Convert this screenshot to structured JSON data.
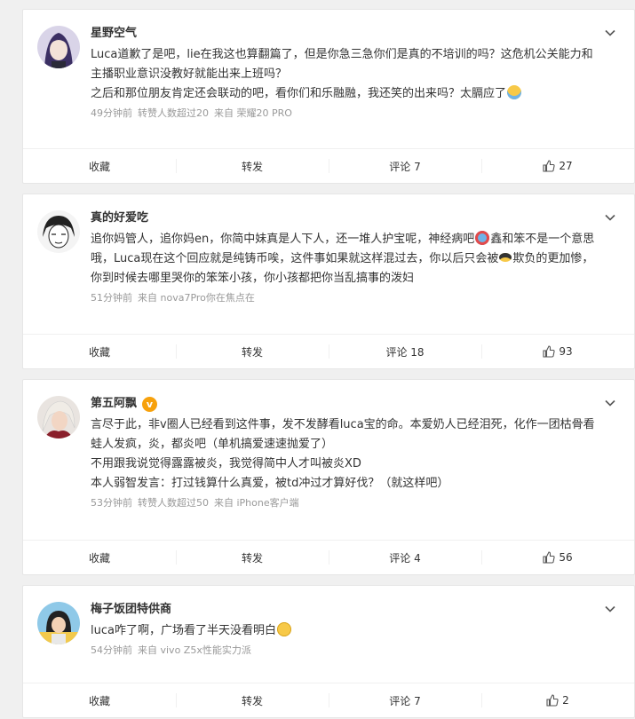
{
  "posts": [
    {
      "username": "星野空气",
      "verified": false,
      "text_1": "Luca道歉了是吧，lie在我这也算翻篇了，但是你急三急你们是真的不培训的吗？这危机公关能力和主播职业意识没教好就能出来上班吗？",
      "text_2": "之后和那位朋友肯定还会联动的吧，看你们和乐融融，我还笑的出来吗？太膈应了",
      "time": "49分钟前",
      "forward_note": "转赞人数超过20",
      "source": "来自 荣耀20 PRO",
      "actions": {
        "collect": "收藏",
        "forward": "转发",
        "comment": "评论 7",
        "like": "27"
      }
    },
    {
      "username": "真的好爱吃",
      "verified": false,
      "text_1": "追你妈管人，追你妈en，你简中妹真是人下人，还一堆人护宝呢，神经病吧",
      "text_2": "鑫和笨不是一个意思哦，Luca现在这个回应就是纯铸币唉，这件事如果就这样混过去，你以后只会被",
      "text_3": "欺负的更加惨，你到时候去哪里哭你的笨笨小孩，你小孩都把你当乱搞事的泼妇",
      "time": "51分钟前",
      "source": "来自 nova7Pro你在焦点在",
      "actions": {
        "collect": "收藏",
        "forward": "转发",
        "comment": "评论 18",
        "like": "93"
      }
    },
    {
      "username": "第五阿飘",
      "verified": true,
      "verified_mark": "v",
      "text_1": "言尽于此，非v圈人已经看到这件事，发不发酵看luca宝的命。本爱奶人已经泪死，化作一团枯骨看蛙人发疯，炎，都炎吧（单机搞爱速速抛爱了）",
      "text_2": "不用跟我说觉得露露被炎，我觉得简中人才叫被炎XD",
      "text_3": "本人弱智发言：打过钱算什么真爱，被td冲过才算好伐？（就这样吧）",
      "time": "53分钟前",
      "forward_note": "转赞人数超过50",
      "source": "来自 iPhone客户端",
      "actions": {
        "collect": "收藏",
        "forward": "转发",
        "comment": "评论 4",
        "like": "56"
      }
    },
    {
      "username": "梅子饭团特供商",
      "verified": false,
      "text_1": "luca咋了啊，广场看了半天没看明白",
      "time": "54分钟前",
      "source": "来自 vivo Z5x性能实力派",
      "actions": {
        "collect": "收藏",
        "forward": "转发",
        "comment": "评论 7",
        "like": "2"
      }
    }
  ],
  "icons": {
    "more": "chevron-down-icon",
    "like": "thumbs-up-icon"
  }
}
